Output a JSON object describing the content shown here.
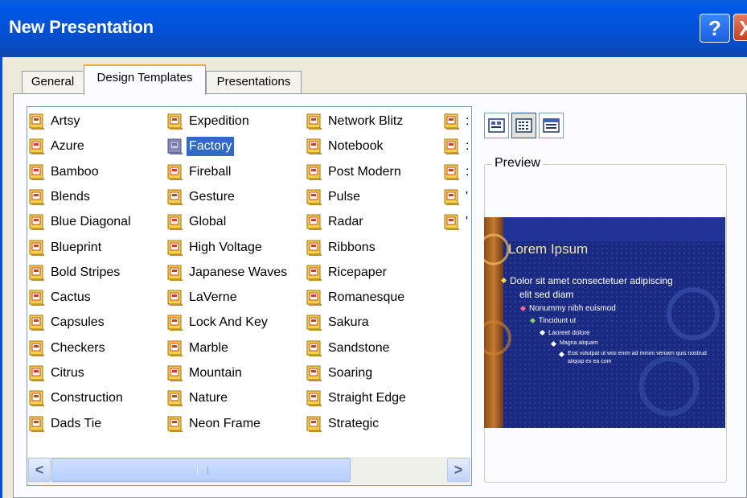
{
  "window": {
    "title": "New Presentation",
    "help_glyph": "?",
    "close_glyph": "X"
  },
  "tabs": [
    {
      "label": "General",
      "selected": false
    },
    {
      "label": "Design Templates",
      "selected": true
    },
    {
      "label": "Presentations",
      "selected": false
    }
  ],
  "templates": {
    "columns": [
      [
        "Artsy",
        "Azure",
        "Bamboo",
        "Blends",
        "Blue Diagonal",
        "Blueprint",
        "Bold Stripes",
        "Cactus",
        "Capsules",
        "Checkers",
        "Citrus",
        "Construction",
        "Dads Tie"
      ],
      [
        "Expedition",
        "Factory",
        "Fireball",
        "Gesture",
        "Global",
        "High Voltage",
        "Japanese Waves",
        "LaVerne",
        "Lock And Key",
        "Marble",
        "Mountain",
        "Nature",
        "Neon Frame"
      ],
      [
        "Network Blitz",
        "Notebook",
        "Post Modern",
        "Pulse",
        "Radar",
        "Ribbons",
        "Ricepaper",
        "Romanesque",
        "Sakura",
        "Sandstone",
        "Soaring",
        "Straight Edge",
        "Strategic"
      ],
      [
        ":",
        ":",
        ":",
        "'",
        "'"
      ]
    ],
    "selected": "Factory"
  },
  "scrollbar": {
    "left_arrow": "<",
    "right_arrow": ">"
  },
  "view_buttons": [
    {
      "name": "large-icons",
      "active": false
    },
    {
      "name": "list",
      "active": true
    },
    {
      "name": "details",
      "active": false
    }
  ],
  "preview": {
    "label": "Preview",
    "slide": {
      "title": "Lorem Ipsum",
      "bullets": [
        "Dolor sit amet consectetuer adipiscing",
        "elit sed diam",
        "Nonummy nibh euismod",
        "Tincidunt ut",
        "Laoreet dolore",
        "Magna aliquam",
        "Erat volutpat ut wisi enim ad minim veniam quis nostrud",
        "aliquip ex ea com"
      ],
      "colors": {
        "background": "#151f6a",
        "title": "#f0e6a0",
        "accent": "#f7d84a",
        "text": "#ffffff"
      }
    }
  },
  "colors": {
    "titlebar": "#0350d4",
    "selection": "#316ac5",
    "dialog": "#ece9d8"
  }
}
